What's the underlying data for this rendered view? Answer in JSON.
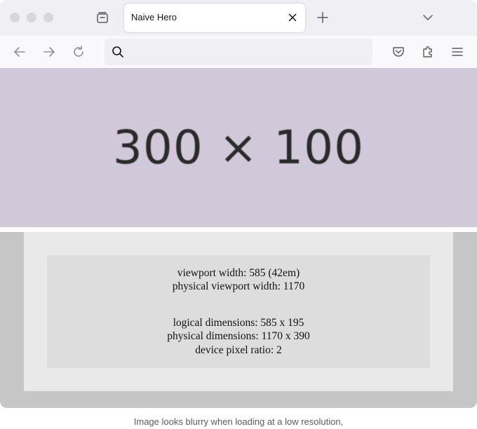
{
  "browser": {
    "tab": {
      "title": "Naive Hero"
    },
    "urlbar": {
      "value": "",
      "placeholder": ""
    }
  },
  "icons": {
    "tab_overview": "tab-overview-icon",
    "tab_close": "close-icon",
    "new_tab": "plus-icon",
    "list_all_tabs": "chevron-down-icon",
    "back": "arrow-left-icon",
    "forward": "arrow-right-icon",
    "reload": "reload-icon",
    "search": "search-icon",
    "pocket": "pocket-icon",
    "extensions": "puzzle-icon",
    "menu": "hamburger-menu-icon"
  },
  "page": {
    "hero_text": "300 × 100",
    "info": {
      "viewport_width": "viewport width: 585 (42em)",
      "physical_viewport_width": "physical viewport width: 1170",
      "logical_dimensions": "logical dimensions: 585 x 195",
      "physical_dimensions": "physical dimensions: 1170 x 390",
      "device_pixel_ratio": "device pixel ratio: 2"
    }
  },
  "caption": "Image looks blurry when loading at a low resolution,",
  "colors": {
    "hero_bg": "#d1c9d9",
    "info_outer_bg": "#e9e9e9",
    "info_inner_bg": "#dddddd",
    "window_bg": "#c6c6c6"
  }
}
